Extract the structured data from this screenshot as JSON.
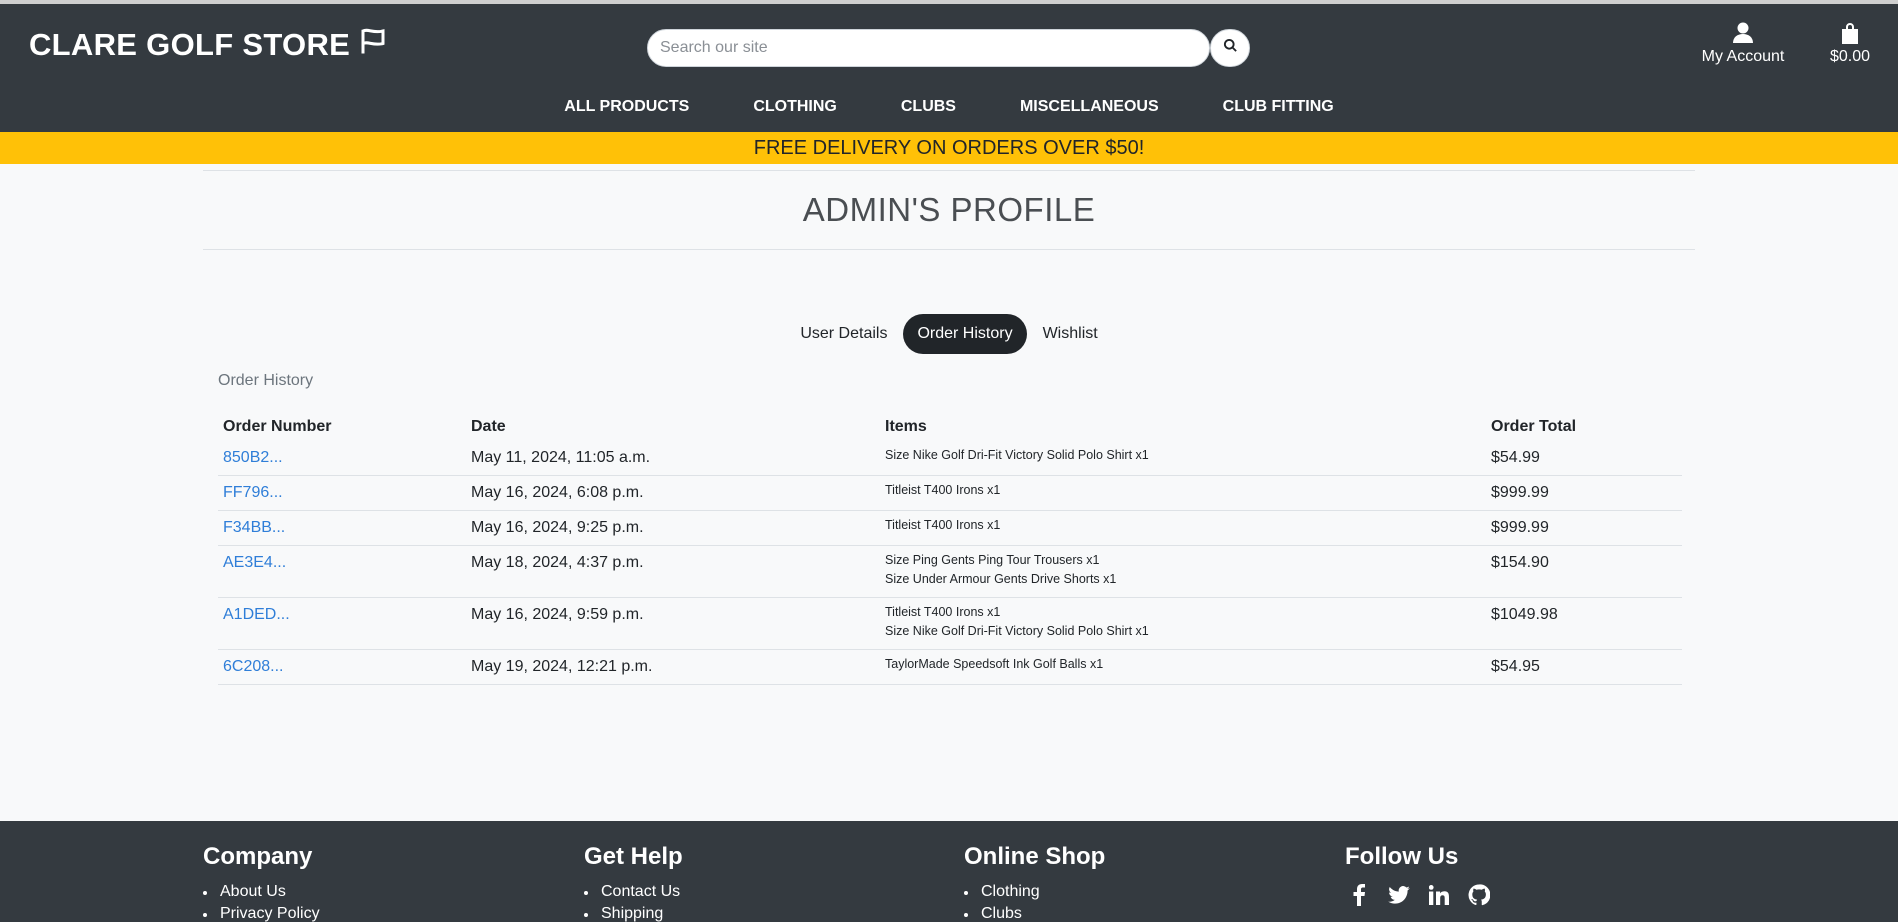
{
  "header": {
    "logo_text": "CLARE GOLF STORE",
    "search_placeholder": "Search our site",
    "account_label": "My Account",
    "cart_total": "$0.00"
  },
  "nav": {
    "items": [
      "ALL PRODUCTS",
      "CLOTHING",
      "CLUBS",
      "MISCELLANEOUS",
      "CLUB FITTING"
    ]
  },
  "banner": {
    "text": "FREE DELIVERY ON ORDERS OVER $50!"
  },
  "profile": {
    "title": "ADMIN'S PROFILE",
    "tabs": [
      "User Details",
      "Order History",
      "Wishlist"
    ],
    "active_tab": "Order History",
    "section_label": "Order History"
  },
  "orders": {
    "headers": [
      "Order Number",
      "Date",
      "Items",
      "Order Total"
    ],
    "rows": [
      {
        "number": "850B2...",
        "date": "May 11, 2024, 11:05 a.m.",
        "items": [
          "Size Nike Golf Dri-Fit Victory Solid Polo Shirt x1"
        ],
        "total": "$54.99"
      },
      {
        "number": "FF796...",
        "date": "May 16, 2024, 6:08 p.m.",
        "items": [
          "Titleist T400 Irons x1"
        ],
        "total": "$999.99"
      },
      {
        "number": "F34BB...",
        "date": "May 16, 2024, 9:25 p.m.",
        "items": [
          "Titleist T400 Irons x1"
        ],
        "total": "$999.99"
      },
      {
        "number": "AE3E4...",
        "date": "May 18, 2024, 4:37 p.m.",
        "items": [
          "Size Ping Gents Ping Tour Trousers x1",
          "Size Under Armour Gents Drive Shorts x1"
        ],
        "total": "$154.90"
      },
      {
        "number": "A1DED...",
        "date": "May 16, 2024, 9:59 p.m.",
        "items": [
          "Titleist T400 Irons x1",
          "Size Nike Golf Dri-Fit Victory Solid Polo Shirt x1"
        ],
        "total": "$1049.98"
      },
      {
        "number": "6C208...",
        "date": "May 19, 2024, 12:21 p.m.",
        "items": [
          "TaylorMade Speedsoft Ink Golf Balls x1"
        ],
        "total": "$54.95"
      }
    ]
  },
  "footer": {
    "company": {
      "title": "Company",
      "links": [
        "About Us",
        "Privacy Policy"
      ]
    },
    "help": {
      "title": "Get Help",
      "links": [
        "Contact Us",
        "Shipping"
      ]
    },
    "shop": {
      "title": "Online Shop",
      "links": [
        "Clothing",
        "Clubs"
      ]
    },
    "follow": {
      "title": "Follow Us",
      "icons": [
        "facebook-icon",
        "twitter-icon",
        "linkedin-icon",
        "github-icon"
      ]
    }
  },
  "colors": {
    "header_bg": "#343a40",
    "banner_bg": "#ffc107",
    "link": "#2f7ed8",
    "active_tab_bg": "#212529"
  }
}
